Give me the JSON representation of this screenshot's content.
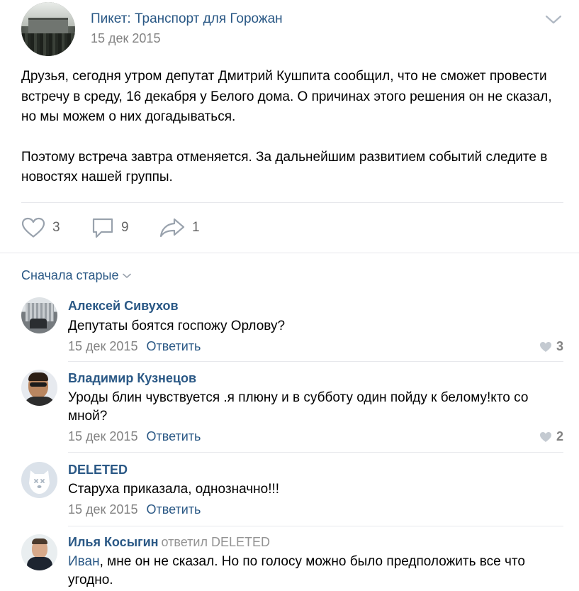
{
  "post": {
    "group_name": "Пикет: Транспорт для Горожан",
    "date": "15 дек 2015",
    "text_p1": "Друзья, сегодня утром депутат Дмитрий Кушпита сообщил, что не сможет провести встречу в среду, 16 декабря у Белого дома. О причинах этого решения он не сказал, но мы можем о них догадываться.",
    "text_p2": "Поэтому встреча завтра отменяется. За дальнейшим развитием событий следите в новостях нашей группы.",
    "likes": "3",
    "comments": "9",
    "shares": "1"
  },
  "comments_section": {
    "sort_label": "Сначала старые"
  },
  "comments": [
    {
      "author": "Алексей Сивухов",
      "text": "Депутаты боятся госпожу Орлову?",
      "date": "15 дек 2015",
      "reply_label": "Ответить",
      "likes": "3"
    },
    {
      "author": "Владимир Кузнецов",
      "text": "Уроды блин чувствуется .я плюну и в субботу один пойду к белому!кто со мной?",
      "date": "15 дек 2015",
      "reply_label": "Ответить",
      "likes": "2"
    },
    {
      "author": "DELETED",
      "text": "Старуха приказала, однозначно!!!",
      "date": "15 дек 2015",
      "reply_label": "Ответить"
    },
    {
      "author": "Илья Косыгин",
      "replied_to": "ответил DELETED",
      "addressee": "Иван",
      "text": ", мне он не сказал. Но по голосу можно было предположить все что угодно."
    }
  ],
  "colors": {
    "link": "#2a5885",
    "meta": "#828282",
    "divider": "#e7e8ec",
    "icon": "#99a2ad"
  }
}
